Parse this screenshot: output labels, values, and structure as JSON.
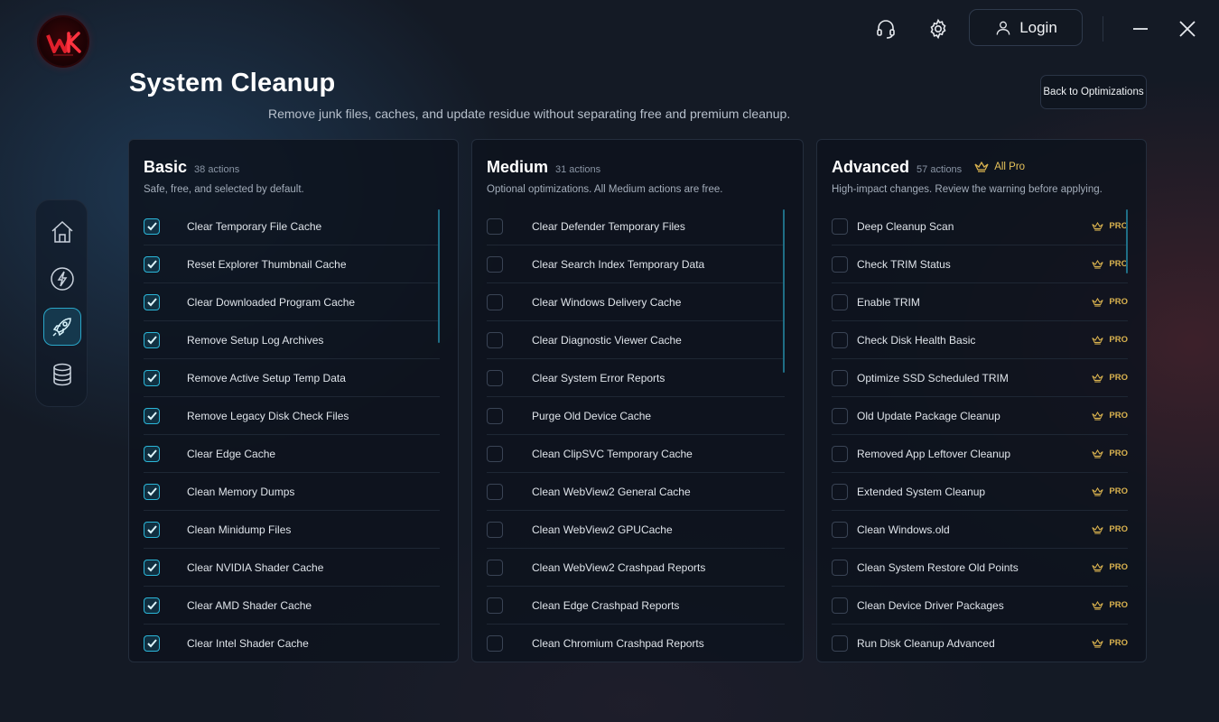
{
  "app": {
    "logo_icon": "wk-logo-icon"
  },
  "toolbar": {
    "support_icon": "headset-icon",
    "settings_icon": "gear-icon",
    "login_label": "Login"
  },
  "header": {
    "title": "System Cleanup",
    "subtitle": "Remove junk files, caches, and update residue without separating free and premium cleanup.",
    "back_label": "Back to Optimizations"
  },
  "nav": [
    {
      "icon": "home-icon",
      "active": false
    },
    {
      "icon": "lightning-icon",
      "active": false
    },
    {
      "icon": "rocket-icon",
      "active": true
    },
    {
      "icon": "database-icon",
      "active": false
    }
  ],
  "panels": {
    "basic": {
      "name": "Basic",
      "count": "38 actions",
      "description": "Safe, free, and selected by default.",
      "items": [
        "Clear Temporary File Cache",
        "Reset Explorer Thumbnail Cache",
        "Clear Downloaded Program Cache",
        "Remove Setup Log Archives",
        "Remove Active Setup Temp Data",
        "Remove Legacy Disk Check Files",
        "Clear Edge Cache",
        "Clean Memory Dumps",
        "Clean Minidump Files",
        "Clear NVIDIA Shader Cache",
        "Clear AMD Shader Cache",
        "Clear Intel Shader Cache"
      ]
    },
    "medium": {
      "name": "Medium",
      "count": "31 actions",
      "description": "Optional optimizations. All Medium actions are free.",
      "items": [
        "Clear Defender Temporary Files",
        "Clear Search Index Temporary Data",
        "Clear Windows Delivery Cache",
        "Clear Diagnostic Viewer Cache",
        "Clear System Error Reports",
        "Purge Old Device Cache",
        "Clean ClipSVC Temporary Cache",
        "Clean WebView2 General Cache",
        "Clean WebView2 GPUCache",
        "Clean WebView2 Crashpad Reports",
        "Clean Edge Crashpad Reports",
        "Clean Chromium Crashpad Reports"
      ]
    },
    "advanced": {
      "name": "Advanced",
      "count": "57 actions",
      "badge": "All Pro",
      "description": "High-impact changes. Review the warning before applying.",
      "pro_label": "PRO",
      "items": [
        "Deep Cleanup Scan",
        "Check TRIM Status",
        "Enable TRIM",
        "Check Disk Health Basic",
        "Optimize SSD Scheduled TRIM",
        "Old Update Package Cleanup",
        "Removed App Leftover Cleanup",
        "Extended System Cleanup",
        "Clean Windows.old",
        "Clean System Restore Old Points",
        "Clean Device Driver Packages",
        "Run Disk Cleanup Advanced"
      ]
    }
  },
  "colors": {
    "accent": "#2bb6d8",
    "pro_gold": "#d9b24f",
    "background": "#141a25"
  }
}
